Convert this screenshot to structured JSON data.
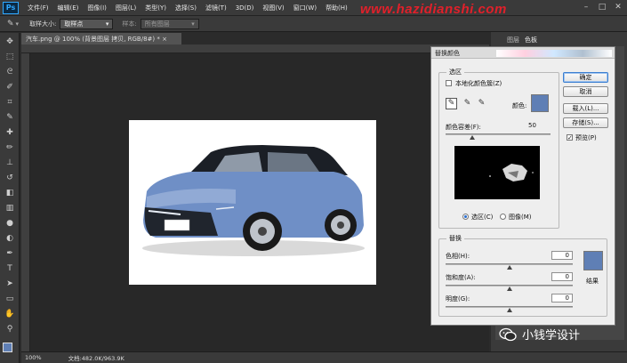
{
  "watermark": "www.hazidianshi.com",
  "menu": [
    "文件(F)",
    "编辑(E)",
    "图像(I)",
    "图层(L)",
    "类型(Y)",
    "选择(S)",
    "滤镜(T)",
    "3D(D)",
    "视图(V)",
    "窗口(W)",
    "帮助(H)"
  ],
  "app_logo": "Ps",
  "options": {
    "sample_size_label": "取样大小:",
    "sample_size_value": "取样点",
    "sample_label": "样本:",
    "sample_value": "所有图层"
  },
  "doc_tab": "汽车.png @ 100% (背景图层 拷贝, RGB/8#) * ×",
  "panel_tabs": {
    "tab1": "图层",
    "tab2": "色板"
  },
  "status": {
    "zoom": "100%",
    "doc_info": "文档:482.0K/963.9K"
  },
  "dialog": {
    "title": "替换颜色",
    "selection_legend": "选区",
    "localized_label": "本地化颜色簇(Z)",
    "color_label": "颜色:",
    "selection_color": "#5f7fb5",
    "fuzziness_label": "颜色容差(F):",
    "fuzziness_value": "50",
    "fuzziness_fraction": 0.25,
    "radio_selection": "选区(C)",
    "radio_image": "图像(M)",
    "replace_legend": "替换",
    "hue_label": "色相(H):",
    "hue_value": "0",
    "saturation_label": "饱和度(A):",
    "saturation_value": "0",
    "lightness_label": "明度(G):",
    "lightness_value": "0",
    "result_label": "结果",
    "result_color": "#5f7fb5",
    "buttons": {
      "ok": "确定",
      "cancel": "取消",
      "load": "载入(L)...",
      "save": "存储(S)..."
    },
    "preview_label": "预览(P)"
  },
  "brand": "小钱学设计"
}
